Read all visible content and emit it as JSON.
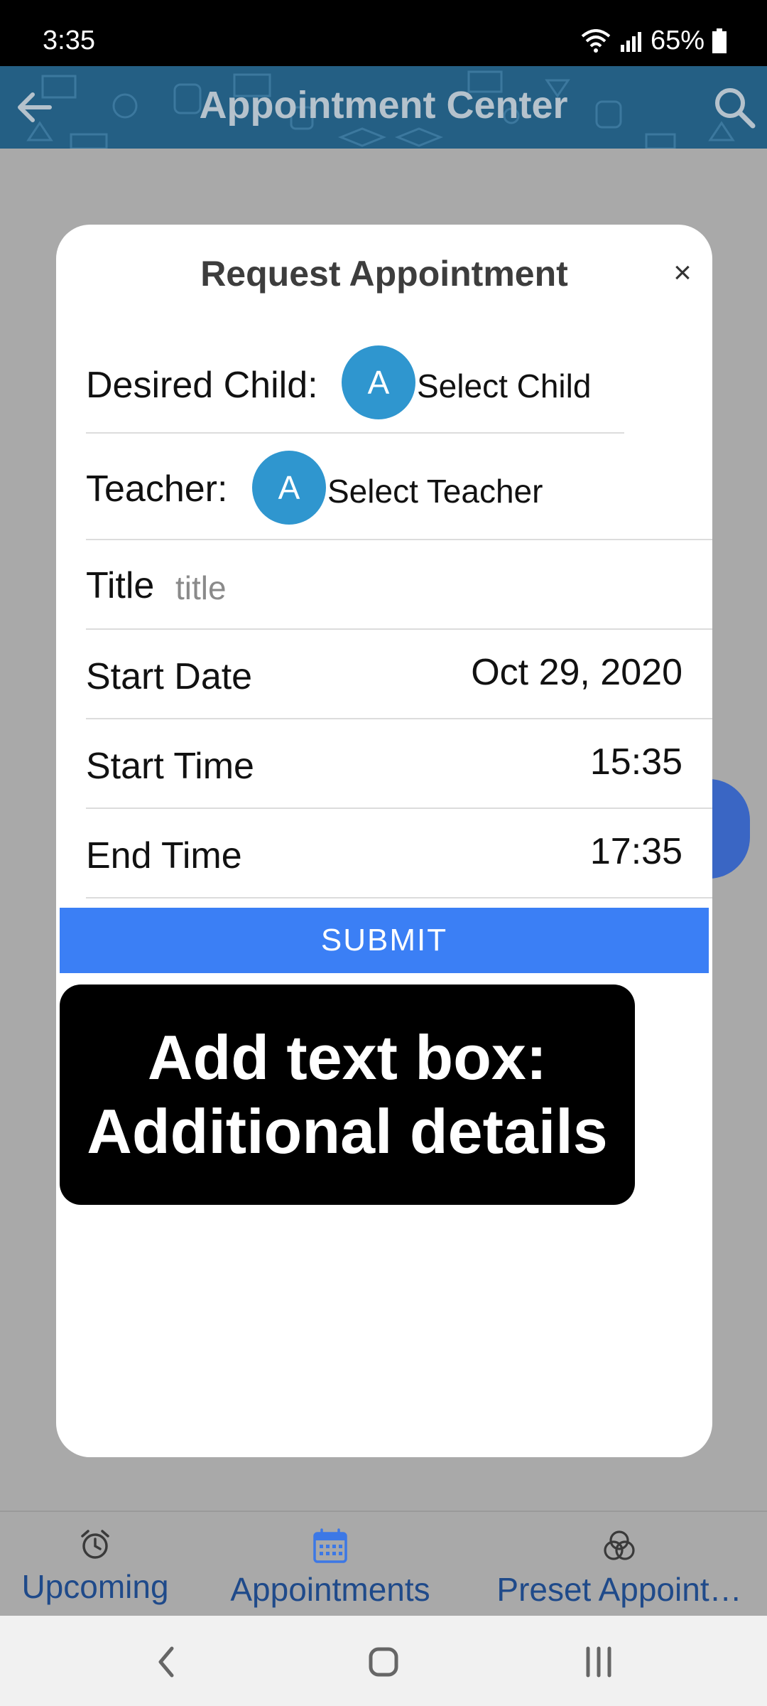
{
  "status_bar": {
    "time": "3:35",
    "battery": "65%"
  },
  "header": {
    "title": "Appointment Center"
  },
  "modal": {
    "title": "Request Appointment",
    "close_label": "×",
    "child_label": "Desired Child:",
    "child_avatar": "A",
    "child_select": "Select Child",
    "teacher_label": "Teacher:",
    "teacher_avatar": "A",
    "teacher_select": "Select Teacher",
    "title_label": "Title",
    "title_placeholder": "title",
    "start_date_label": "Start Date",
    "start_date_value": "Oct 29, 2020",
    "start_time_label": "Start Time",
    "start_time_value": "15:35",
    "end_time_label": "End Time",
    "end_time_value": "17:35",
    "submit_label": "SUBMIT"
  },
  "annotation": {
    "line1": "Add text box:",
    "line2": "Additional details"
  },
  "bottom_nav": {
    "items": [
      {
        "label": "Upcoming",
        "icon": "alarm-clock-icon"
      },
      {
        "label": "Appointments",
        "icon": "calendar-icon"
      },
      {
        "label": "Preset Appoint…",
        "icon": "circles-icon"
      }
    ]
  },
  "colors": {
    "header": "#245f84",
    "submit": "#3b7ff5",
    "avatar": "#2f96cf",
    "nav_text": "#1f4a8a"
  }
}
